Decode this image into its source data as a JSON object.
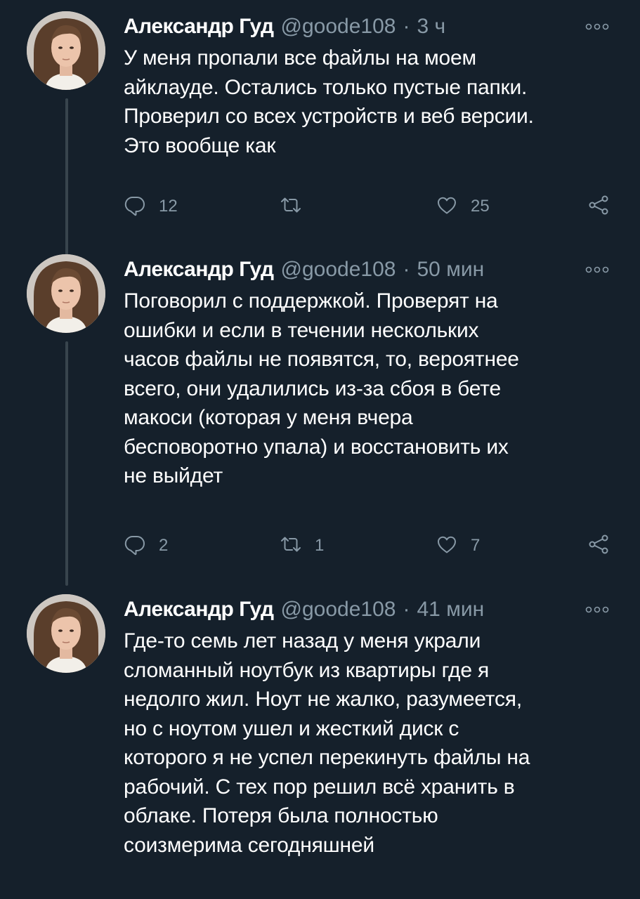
{
  "tweets": [
    {
      "author": "Александр Гуд",
      "handle": "@goode108",
      "separator": "·",
      "time": "3 ч",
      "lines": [
        "У меня пропали все файлы на моем",
        "айклауде. Остались только пустые папки.",
        "Проверил со всех устройств и веб версии.",
        "Это вообще как"
      ],
      "replies": "12",
      "retweets": "",
      "likes": "25"
    },
    {
      "author": "Александр Гуд",
      "handle": "@goode108",
      "separator": "·",
      "time": "50 мин",
      "lines": [
        "Поговорил с поддержкой. Проверят на",
        "ошибки и если в течении нескольких",
        "часов файлы не появятся, то, вероятнее",
        "всего, они удалились из-за сбоя в бете",
        "макоси (которая у меня вчера",
        "бесповоротно упала) и восстановить их",
        "не выйдет"
      ],
      "replies": "2",
      "retweets": "1",
      "likes": "7"
    },
    {
      "author": "Александр Гуд",
      "handle": "@goode108",
      "separator": "·",
      "time": "41 мин",
      "lines": [
        "Где-то семь лет назад у меня украли",
        "сломанный ноутбук из квартиры где я",
        "недолго жил. Ноут не жалко, разумеется,",
        "но с ноутом ушел и жесткий диск с",
        "которого я не успел перекинуть файлы на",
        "рабочий. С тех пор решил всё хранить в",
        "облаке. Потеря была полностью",
        "соизмерима сегодняшней"
      ]
    }
  ],
  "icons": {
    "reply": "reply-icon",
    "retweet": "retweet-icon",
    "like": "heart-icon",
    "share": "share-icon",
    "more": "more-icon"
  },
  "colors": {
    "background": "#15202b",
    "text": "#ffffff",
    "secondary": "#8899a6",
    "thread_line": "#38444d"
  }
}
